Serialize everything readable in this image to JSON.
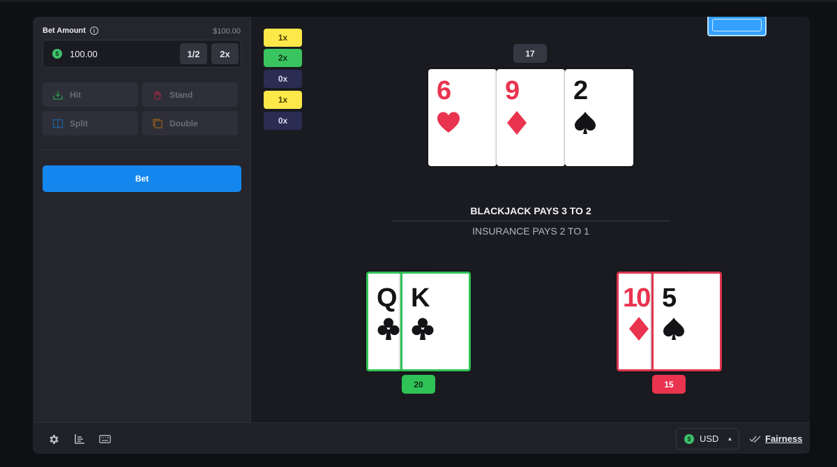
{
  "sidebar": {
    "bet_label": "Bet Amount",
    "balance": "$100.00",
    "bet_value": "100.00",
    "half_label": "1/2",
    "double_label": "2x",
    "hit_label": "Hit",
    "stand_label": "Stand",
    "split_label": "Split",
    "double_down_label": "Double",
    "bet_button_label": "Bet"
  },
  "multipliers": [
    "1x",
    "2x",
    "0x",
    "1x",
    "0x"
  ],
  "dealer": {
    "score": "17",
    "cards": [
      {
        "rank": "6",
        "suit": "hearts",
        "color": "red"
      },
      {
        "rank": "9",
        "suit": "diamonds",
        "color": "red"
      },
      {
        "rank": "2",
        "suit": "spades",
        "color": "black"
      }
    ]
  },
  "rules": {
    "blackjack": "BLACKJACK PAYS 3 TO 2",
    "insurance": "INSURANCE PAYS 2 TO 1"
  },
  "player_hands": [
    {
      "score": "20",
      "result": "win",
      "cards": [
        {
          "rank": "Q",
          "suit": "clubs",
          "color": "black"
        },
        {
          "rank": "K",
          "suit": "clubs",
          "color": "black"
        }
      ]
    },
    {
      "score": "15",
      "result": "lose",
      "cards": [
        {
          "rank": "10",
          "suit": "diamonds",
          "color": "red"
        },
        {
          "rank": "5",
          "suit": "spades",
          "color": "black"
        }
      ]
    }
  ],
  "footer": {
    "currency": "USD",
    "fairness": "Fairness"
  },
  "colors": {
    "accent": "#1487ee",
    "win": "#2fc257",
    "lose": "#e9334f",
    "multiplier_yellow": "#fde84a",
    "multiplier_green": "#3ac45f",
    "multiplier_dark": "#2b2c52"
  },
  "icons": [
    "info-icon",
    "dollar-coin-icon",
    "hit-icon",
    "stand-hand-icon",
    "split-icon",
    "double-icon",
    "settings-gear-icon",
    "stats-chart-icon",
    "keyboard-icon",
    "caret-up-icon",
    "fairness-check-icon",
    "heart-suit-icon",
    "diamond-suit-icon",
    "spade-suit-icon",
    "club-suit-icon"
  ]
}
